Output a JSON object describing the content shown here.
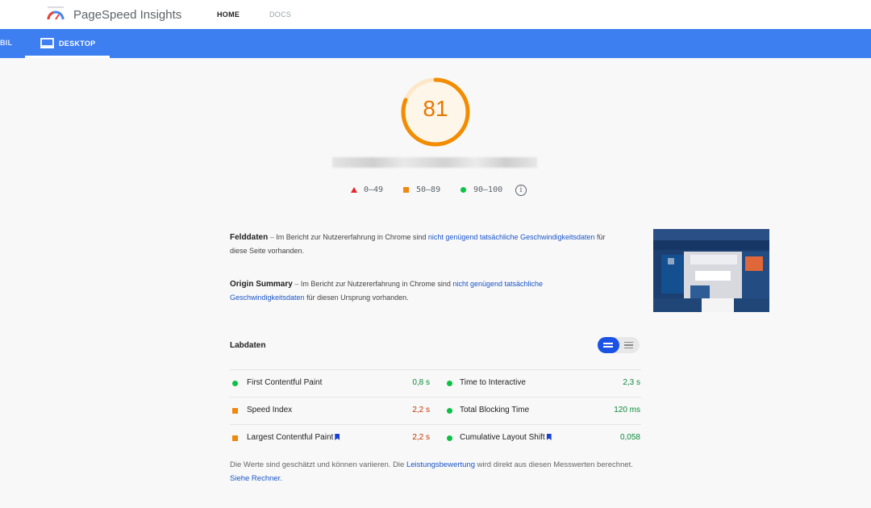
{
  "header": {
    "brand": "PageSpeed Insights",
    "nav": {
      "home": "HOME",
      "docs": "DOCS"
    }
  },
  "tabs": {
    "mobile": "BIL",
    "desktop": "DESKTOP"
  },
  "score": {
    "value": "81",
    "fraction": 0.81,
    "color": "#f28c00"
  },
  "legend": {
    "poor": "0–49",
    "average": "50–89",
    "good": "90–100"
  },
  "felddaten": {
    "title": "Felddaten",
    "dash": "–",
    "text_before": "Im Bericht zur Nutzererfahrung in Chrome sind",
    "link": "nicht genügend tatsächliche Geschwindigkeitsdaten",
    "text_after": "für diese Seite vorhanden."
  },
  "origin": {
    "title": "Origin Summary",
    "dash": "–",
    "text_before": "Im Bericht zur Nutzererfahrung in Chrome sind",
    "link": "nicht genügend tatsächliche Geschwindigkeitsdaten",
    "text_after": "für diesen Ursprung vorhanden."
  },
  "labdaten": {
    "title": "Labdaten"
  },
  "metrics": {
    "fcp": {
      "label": "First Contentful Paint",
      "value": "0,8 s"
    },
    "tti": {
      "label": "Time to Interactive",
      "value": "2,3 s"
    },
    "si": {
      "label": "Speed Index",
      "value": "2,2 s"
    },
    "tbt": {
      "label": "Total Blocking Time",
      "value": "120 ms"
    },
    "lcp": {
      "label": "Largest Contentful Paint",
      "value": "2,2 s"
    },
    "cls": {
      "label": "Cumulative Layout Shift",
      "value": "0,058"
    }
  },
  "footer": {
    "text1": "Die Werte sind geschätzt und können variieren. Die",
    "link1": "Leistungsbewertung",
    "text2": "wird direkt aus diesen Messwerten berechnet.",
    "link2": "Siehe Rechner."
  },
  "icons": {
    "logo": "pagespeed-gauge-icon",
    "desktop": "monitor-icon",
    "info": "info-icon",
    "bookmark": "bookmark-icon"
  },
  "colors": {
    "blue_bar": "#3d7ef0",
    "score_orange": "#f28c00",
    "good": "#0cc144",
    "average": "#f0870e",
    "poor": "#e8242d",
    "link": "#1a55c8"
  }
}
